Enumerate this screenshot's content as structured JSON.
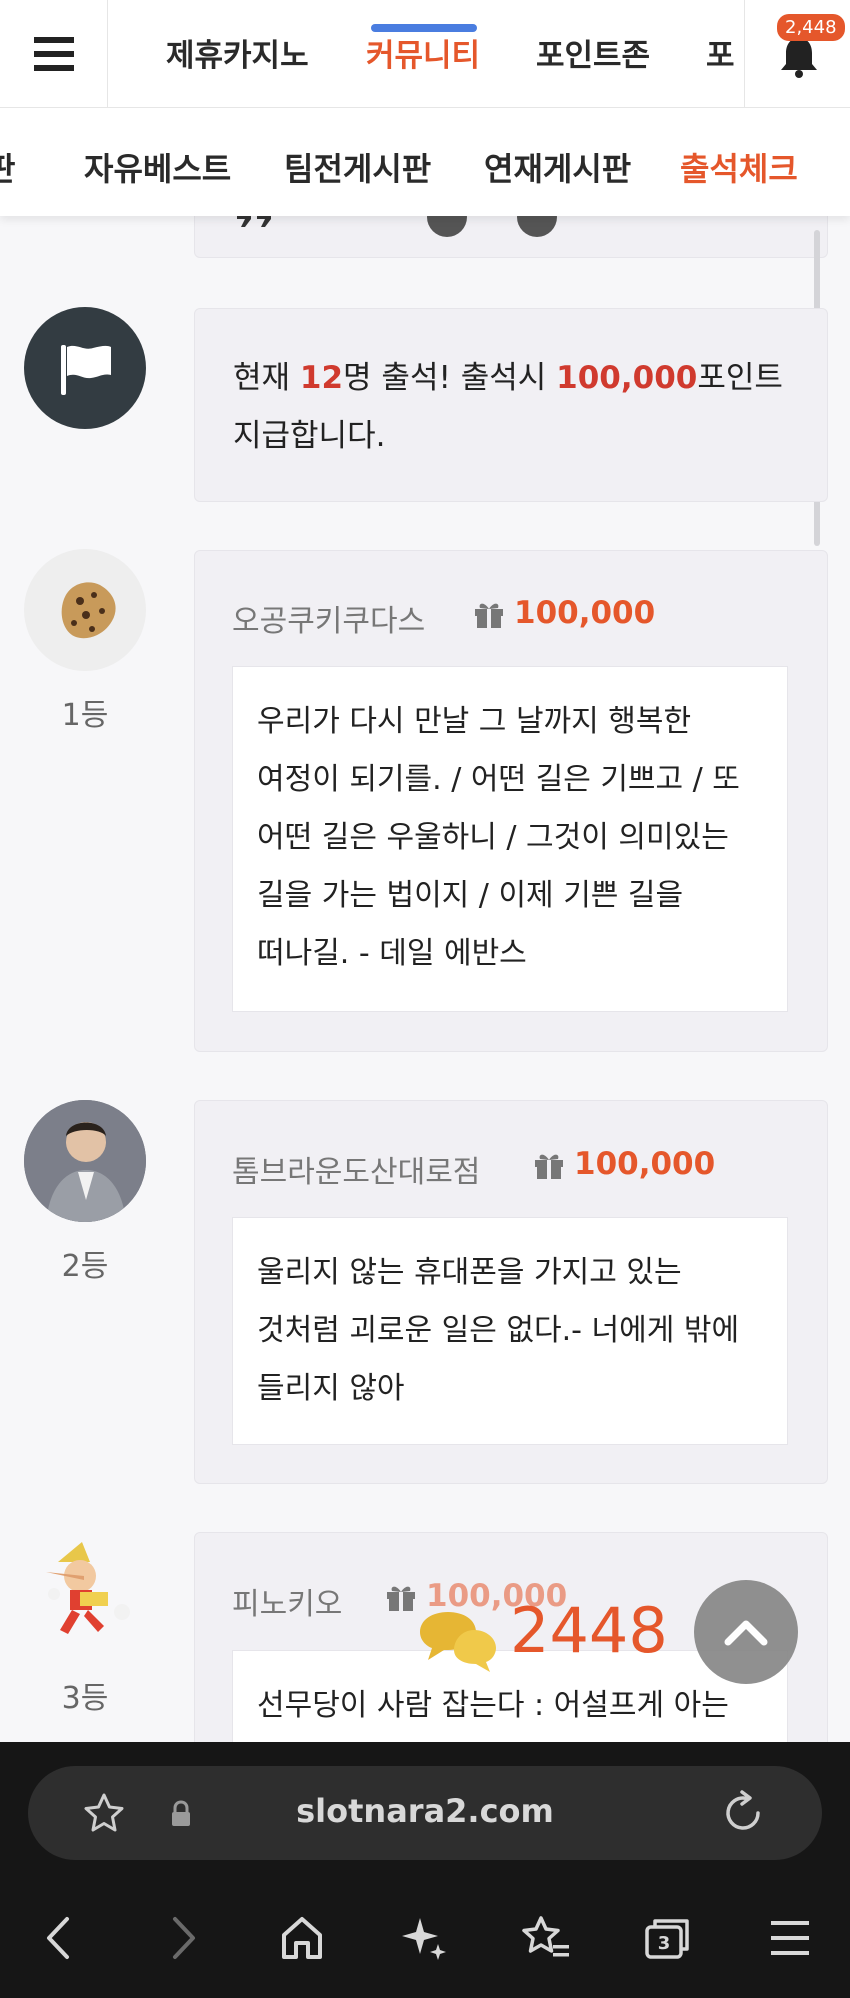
{
  "topnav": {
    "tabs": [
      {
        "label": "제휴카지노"
      },
      {
        "label": "커뮤니티"
      },
      {
        "label": "포인트존"
      },
      {
        "label": "포"
      }
    ],
    "notification_count": "2,448"
  },
  "subnav": {
    "items": [
      {
        "label": "판"
      },
      {
        "label": "자유베스트"
      },
      {
        "label": "팀전게시판"
      },
      {
        "label": "연재게시판"
      },
      {
        "label": "출석체크"
      }
    ]
  },
  "notice": {
    "prefix": "현재 ",
    "count": "12",
    "mid": "명 출석! 출석시 ",
    "points": "100,000",
    "suffix": "포인트",
    "line2": "지급합니다."
  },
  "entries": [
    {
      "rank": "1등",
      "nickname": "오공쿠키쿠다스",
      "points": "100,000",
      "message": "우리가 다시 만날 그 날까지 행복한 여정이 되기를. / 어떤 길은 기쁘고 / 또 어떤 길은 우울하니 / 그것이 의미있는 길을 가는 법이지 / 이제 기쁜 길을 떠나길. - 데일 에반스"
    },
    {
      "rank": "2등",
      "nickname": "톰브라운도산대로점",
      "points": "100,000",
      "message": "울리지 않는 휴대폰을 가지고 있는 것처럼 괴로운 일은 없다.- 너에게 밖에 들리지 않아"
    },
    {
      "rank": "3등",
      "nickname": "피노키오",
      "points": "100,000",
      "message": "선무당이 사람 잡는다 : 어설프게 아는"
    }
  ],
  "floating": {
    "chat_count": "2448"
  },
  "browser": {
    "url": "slotnara2.com",
    "tab_count": "3"
  },
  "colors": {
    "accent": "#e5572b",
    "indicator": "#4a7de0",
    "card_bg": "#f1f0f4"
  }
}
